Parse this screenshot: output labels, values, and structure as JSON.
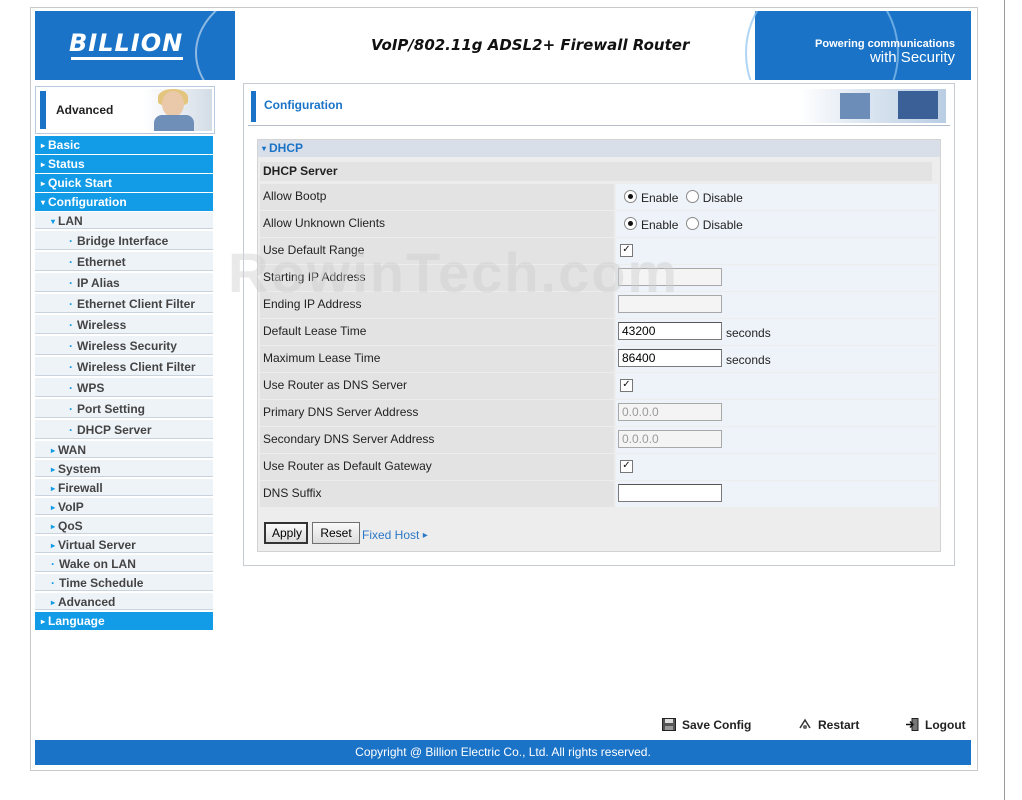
{
  "header": {
    "logo": "BILLION",
    "product_title": "VoIP/802.11g ADSL2+ Firewall Router",
    "tagline_line1": "Powering communications",
    "tagline_line2": "with Security"
  },
  "mode_label": "Advanced",
  "nav": {
    "top": [
      {
        "label": "Basic"
      },
      {
        "label": "Status"
      },
      {
        "label": "Quick Start"
      },
      {
        "label": "Configuration"
      }
    ],
    "lan_label": "LAN",
    "lan_items": [
      "Bridge Interface",
      "Ethernet",
      "IP Alias",
      "Ethernet Client Filter",
      "Wireless",
      "Wireless Security",
      "Wireless Client Filter",
      "WPS",
      "Port Setting",
      "DHCP Server"
    ],
    "config_items": [
      "WAN",
      "System",
      "Firewall",
      "VoIP",
      "QoS",
      "Virtual Server",
      "Wake on LAN",
      "Time Schedule",
      "Advanced"
    ],
    "language": "Language"
  },
  "page": {
    "title": "Configuration",
    "section": "DHCP",
    "subsection": "DHCP Server"
  },
  "form": {
    "allow_bootp": {
      "label": "Allow Bootp",
      "enable": "Enable",
      "disable": "Disable",
      "value": "Enable"
    },
    "allow_unknown": {
      "label": "Allow Unknown Clients",
      "enable": "Enable",
      "disable": "Disable",
      "value": "Enable"
    },
    "use_default_range": {
      "label": "Use Default Range",
      "checked": true
    },
    "starting_ip": {
      "label": "Starting IP Address",
      "value": ""
    },
    "ending_ip": {
      "label": "Ending IP Address",
      "value": ""
    },
    "default_lease": {
      "label": "Default Lease Time",
      "value": "43200",
      "unit": "seconds"
    },
    "max_lease": {
      "label": "Maximum Lease Time",
      "value": "86400",
      "unit": "seconds"
    },
    "router_dns": {
      "label": "Use Router as DNS Server",
      "checked": true
    },
    "primary_dns": {
      "label": "Primary DNS Server Address",
      "value": "0.0.0.0"
    },
    "secondary_dns": {
      "label": "Secondary DNS Server Address",
      "value": "0.0.0.0"
    },
    "router_gateway": {
      "label": "Use Router as Default Gateway",
      "checked": true
    },
    "dns_suffix": {
      "label": "DNS Suffix",
      "value": ""
    }
  },
  "buttons": {
    "apply": "Apply",
    "reset": "Reset",
    "fixed_host": "Fixed Host"
  },
  "watermark": "RowinTech.com",
  "footer": {
    "save": "Save Config",
    "restart": "Restart",
    "logout": "Logout",
    "copyright": "Copyright @ Billion Electric Co., Ltd. All rights reserved."
  },
  "colors": {
    "brand_blue": "#1a73c7",
    "nav_blue": "#129be7"
  }
}
